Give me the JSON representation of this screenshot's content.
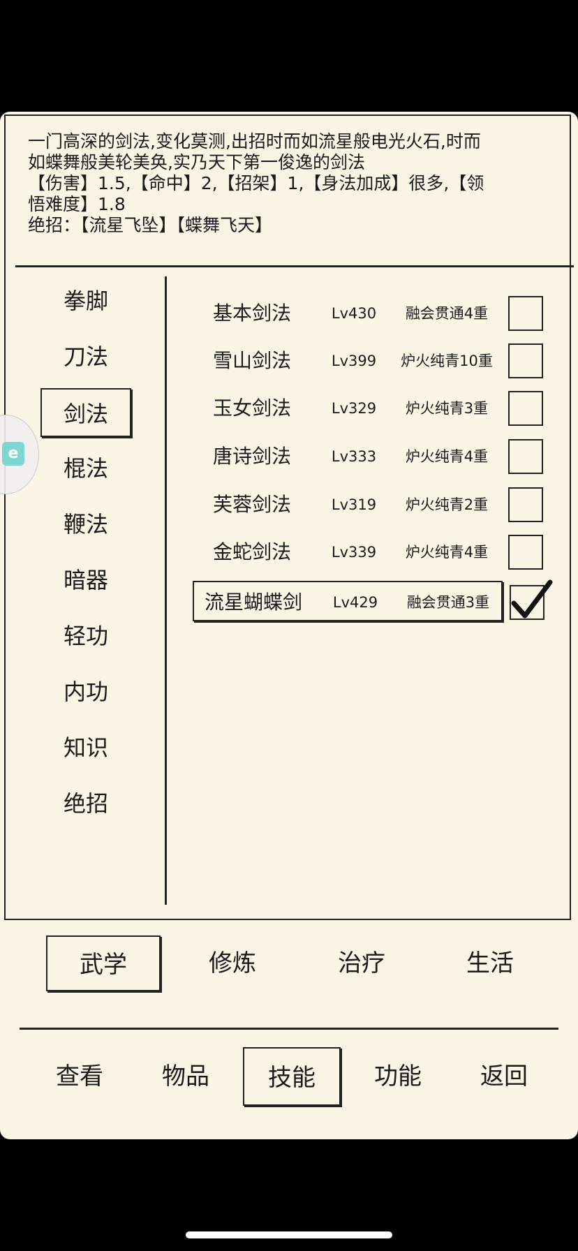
{
  "description": {
    "lines": [
      "一门高深的剑法,变化莫测,出招时而如流星般电光火石,时而",
      "如蝶舞般美轮美奂,实乃天下第一俊逸的剑法",
      "【伤害】1.5,【命中】2,【招架】1,【身法加成】很多,【领",
      "悟难度】1.8",
      "绝招：【流星飞坠】【蝶舞飞天】"
    ]
  },
  "categories": [
    {
      "label": "拳脚",
      "selected": false
    },
    {
      "label": "刀法",
      "selected": false
    },
    {
      "label": "剑法",
      "selected": true
    },
    {
      "label": "棍法",
      "selected": false
    },
    {
      "label": "鞭法",
      "selected": false
    },
    {
      "label": "暗器",
      "selected": false
    },
    {
      "label": "轻功",
      "selected": false
    },
    {
      "label": "内功",
      "selected": false
    },
    {
      "label": "知识",
      "selected": false
    },
    {
      "label": "绝招",
      "selected": false
    }
  ],
  "skills": [
    {
      "name": "基本剑法",
      "level": "Lv430",
      "mastery": "融会贯通4重",
      "checked": false
    },
    {
      "name": "雪山剑法",
      "level": "Lv399",
      "mastery": "炉火纯青10重",
      "checked": false
    },
    {
      "name": "玉女剑法",
      "level": "Lv329",
      "mastery": "炉火纯青3重",
      "checked": false
    },
    {
      "name": "唐诗剑法",
      "level": "Lv333",
      "mastery": "炉火纯青4重",
      "checked": false
    },
    {
      "name": "芙蓉剑法",
      "level": "Lv319",
      "mastery": "炉火纯青2重",
      "checked": false
    },
    {
      "name": "金蛇剑法",
      "level": "Lv339",
      "mastery": "炉火纯青4重",
      "checked": false
    },
    {
      "name": "流星蝴蝶剑",
      "level": "Lv429",
      "mastery": "融会贯通3重",
      "checked": true
    }
  ],
  "sub_tabs": [
    {
      "label": "武学",
      "selected": true
    },
    {
      "label": "修炼",
      "selected": false
    },
    {
      "label": "治疗",
      "selected": false
    },
    {
      "label": "生活",
      "selected": false
    }
  ],
  "nav": [
    {
      "label": "查看",
      "selected": false
    },
    {
      "label": "物品",
      "selected": false
    },
    {
      "label": "技能",
      "selected": true
    },
    {
      "label": "功能",
      "selected": false
    },
    {
      "label": "返回",
      "selected": false
    }
  ],
  "float_widget": {
    "icon": "app-shortcut-icon",
    "glyph": "e",
    "color": "#7dd6cf"
  }
}
